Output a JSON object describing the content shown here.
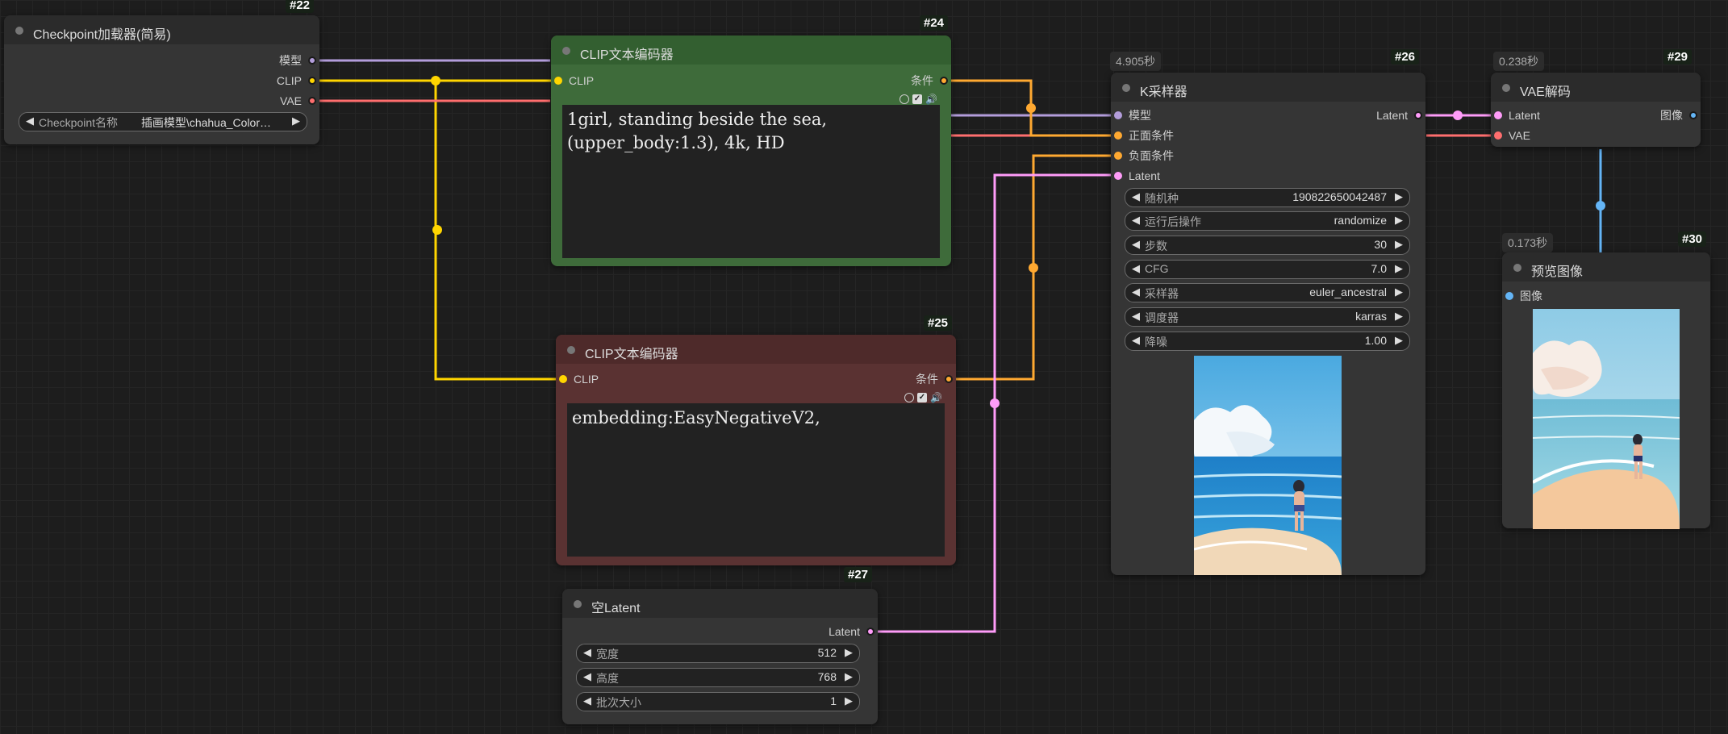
{
  "colors": {
    "model": "#b39ddb",
    "clip": "#ffd500",
    "vae": "#ff6e6e",
    "conditioning": "#ffa931",
    "latent": "#ff9cf9",
    "image": "#64b5f6"
  },
  "nodes": {
    "checkpoint": {
      "id": "#22",
      "title": "Checkpoint加载器(简易)",
      "outputs": {
        "model": "模型",
        "clip": "CLIP",
        "vae": "VAE"
      },
      "ckpt": {
        "label": "Checkpoint名称",
        "value": "插画模型\\chahua_Color…"
      }
    },
    "clip_pos": {
      "id": "#24",
      "title": "CLIP文本编码器",
      "input": "CLIP",
      "output": "条件",
      "text": "1girl, standing beside the sea,\n(upper_body:1.3), 4k, HD"
    },
    "clip_neg": {
      "id": "#25",
      "title": "CLIP文本编码器",
      "input": "CLIP",
      "output": "条件",
      "text": "embedding:EasyNegativeV2,"
    },
    "latent": {
      "id": "#27",
      "title": "空Latent",
      "output": "Latent",
      "widgets": [
        {
          "label": "宽度",
          "value": "512"
        },
        {
          "label": "高度",
          "value": "768"
        },
        {
          "label": "批次大小",
          "value": "1"
        }
      ]
    },
    "ksampler": {
      "id": "#26",
      "title": "K采样器",
      "time": "4.905秒",
      "inputs": [
        "模型",
        "正面条件",
        "负面条件",
        "Latent"
      ],
      "output": "Latent",
      "widgets": [
        {
          "label": "随机种",
          "value": "190822650042487"
        },
        {
          "label": "运行后操作",
          "value": "randomize"
        },
        {
          "label": "步数",
          "value": "30"
        },
        {
          "label": "CFG",
          "value": "7.0"
        },
        {
          "label": "采样器",
          "value": "euler_ancestral"
        },
        {
          "label": "调度器",
          "value": "karras"
        },
        {
          "label": "降噪",
          "value": "1.00"
        }
      ]
    },
    "vae_decode": {
      "id": "#29",
      "title": "VAE解码",
      "time": "0.238秒",
      "inputs": [
        "Latent",
        "VAE"
      ],
      "output": "图像"
    },
    "preview": {
      "id": "#30",
      "title": "预览图像",
      "time": "0.173秒",
      "input": "图像"
    }
  }
}
